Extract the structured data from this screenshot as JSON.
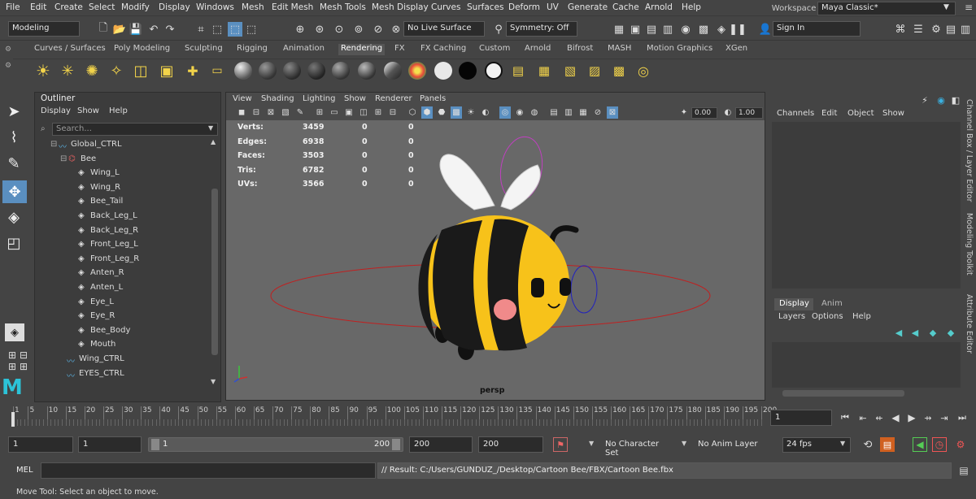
{
  "menubar": {
    "items": [
      "File",
      "Edit",
      "Create",
      "Select",
      "Modify",
      "Display",
      "Windows",
      "Mesh",
      "Edit Mesh",
      "Mesh Tools",
      "Mesh Display",
      "Curves",
      "Surfaces",
      "Deform",
      "UV",
      "Generate",
      "Cache",
      "Arnold",
      "Help"
    ],
    "workspace_label": "Workspace :",
    "workspace_value": "Maya Classic*"
  },
  "toolbar": {
    "mode_value": "Modeling",
    "live_surface": "No Live Surface",
    "symmetry": "Symmetry: Off",
    "sign_in": "Sign In"
  },
  "shelf": {
    "tabs": [
      "Curves / Surfaces",
      "Poly Modeling",
      "Sculpting",
      "Rigging",
      "Animation",
      "Rendering",
      "FX",
      "FX Caching",
      "Custom",
      "Arnold",
      "Bifrost",
      "MASH",
      "Motion Graphics",
      "XGen"
    ],
    "active_tab": "Rendering"
  },
  "outliner": {
    "title": "Outliner",
    "menu": [
      "Display",
      "Show",
      "Help"
    ],
    "search_placeholder": "Search...",
    "rows": [
      {
        "label": "Global_CTRL",
        "type": "curve"
      },
      {
        "label": "Bee",
        "type": "group"
      },
      {
        "label": "Wing_L",
        "type": "mesh"
      },
      {
        "label": "Wing_R",
        "type": "mesh"
      },
      {
        "label": "Bee_Tail",
        "type": "mesh"
      },
      {
        "label": "Back_Leg_L",
        "type": "mesh"
      },
      {
        "label": "Back_Leg_R",
        "type": "mesh"
      },
      {
        "label": "Front_Leg_L",
        "type": "mesh"
      },
      {
        "label": "Front_Leg_R",
        "type": "mesh"
      },
      {
        "label": "Anten_R",
        "type": "mesh"
      },
      {
        "label": "Anten_L",
        "type": "mesh"
      },
      {
        "label": "Eye_L",
        "type": "mesh"
      },
      {
        "label": "Eye_R",
        "type": "mesh"
      },
      {
        "label": "Bee_Body",
        "type": "mesh"
      },
      {
        "label": "Mouth",
        "type": "mesh"
      },
      {
        "label": "Wing_CTRL",
        "type": "curve"
      },
      {
        "label": "EYES_CTRL",
        "type": "curve"
      }
    ]
  },
  "viewport": {
    "menu": [
      "View",
      "Shading",
      "Lighting",
      "Show",
      "Renderer",
      "Panels"
    ],
    "field_a": "0.00",
    "field_b": "1.00",
    "camera": "persp",
    "stats": [
      {
        "label": "Verts:",
        "v1": "3459",
        "v2": "0",
        "v3": "0"
      },
      {
        "label": "Edges:",
        "v1": "6938",
        "v2": "0",
        "v3": "0"
      },
      {
        "label": "Faces:",
        "v1": "3503",
        "v2": "0",
        "v3": "0"
      },
      {
        "label": "Tris:",
        "v1": "6782",
        "v2": "0",
        "v3": "0"
      },
      {
        "label": "UVs:",
        "v1": "3566",
        "v2": "0",
        "v3": "0"
      }
    ]
  },
  "channelbox": {
    "menu": [
      "Channels",
      "Edit",
      "Object",
      "Show"
    ],
    "tabs": [
      "Display",
      "Anim"
    ],
    "layer_menu": [
      "Layers",
      "Options",
      "Help"
    ],
    "side_tabs": [
      "Channel Box / Layer Editor",
      "Modeling Toolkit",
      "Attribute Editor"
    ]
  },
  "timeline": {
    "ticks": [
      "1",
      "5",
      "10",
      "15",
      "20",
      "25",
      "30",
      "35",
      "40",
      "45",
      "50",
      "55",
      "60",
      "65",
      "70",
      "75",
      "80",
      "85",
      "90",
      "95",
      "100",
      "105",
      "110",
      "115",
      "120",
      "125",
      "130",
      "135",
      "140",
      "145",
      "150",
      "155",
      "160",
      "165",
      "170",
      "175",
      "180",
      "185",
      "190",
      "195",
      "200"
    ],
    "current_frame": "1"
  },
  "range": {
    "start": "1",
    "start_inner": "1",
    "slider_start": "1",
    "slider_end": "200",
    "end_inner": "200",
    "end": "200",
    "character_set": "No Character Set",
    "anim_layer": "No Anim Layer",
    "fps": "24 fps"
  },
  "cmdline": {
    "label": "MEL",
    "result": "// Result: C:/Users/GUNDUZ_/Desktop/Cartoon Bee/FBX/Cartoon Bee.fbx"
  },
  "helpline": {
    "text": "Move Tool: Select an object to move."
  },
  "colors": {
    "bee_yellow": "#f7c21a",
    "bee_black": "#1a1a1a",
    "cheek": "#f08a8a",
    "ctrl_red": "#c02020",
    "ctrl_magenta": "#c040c0",
    "ctrl_blue": "#2020c0",
    "active_blue": "#5a8fc0"
  }
}
